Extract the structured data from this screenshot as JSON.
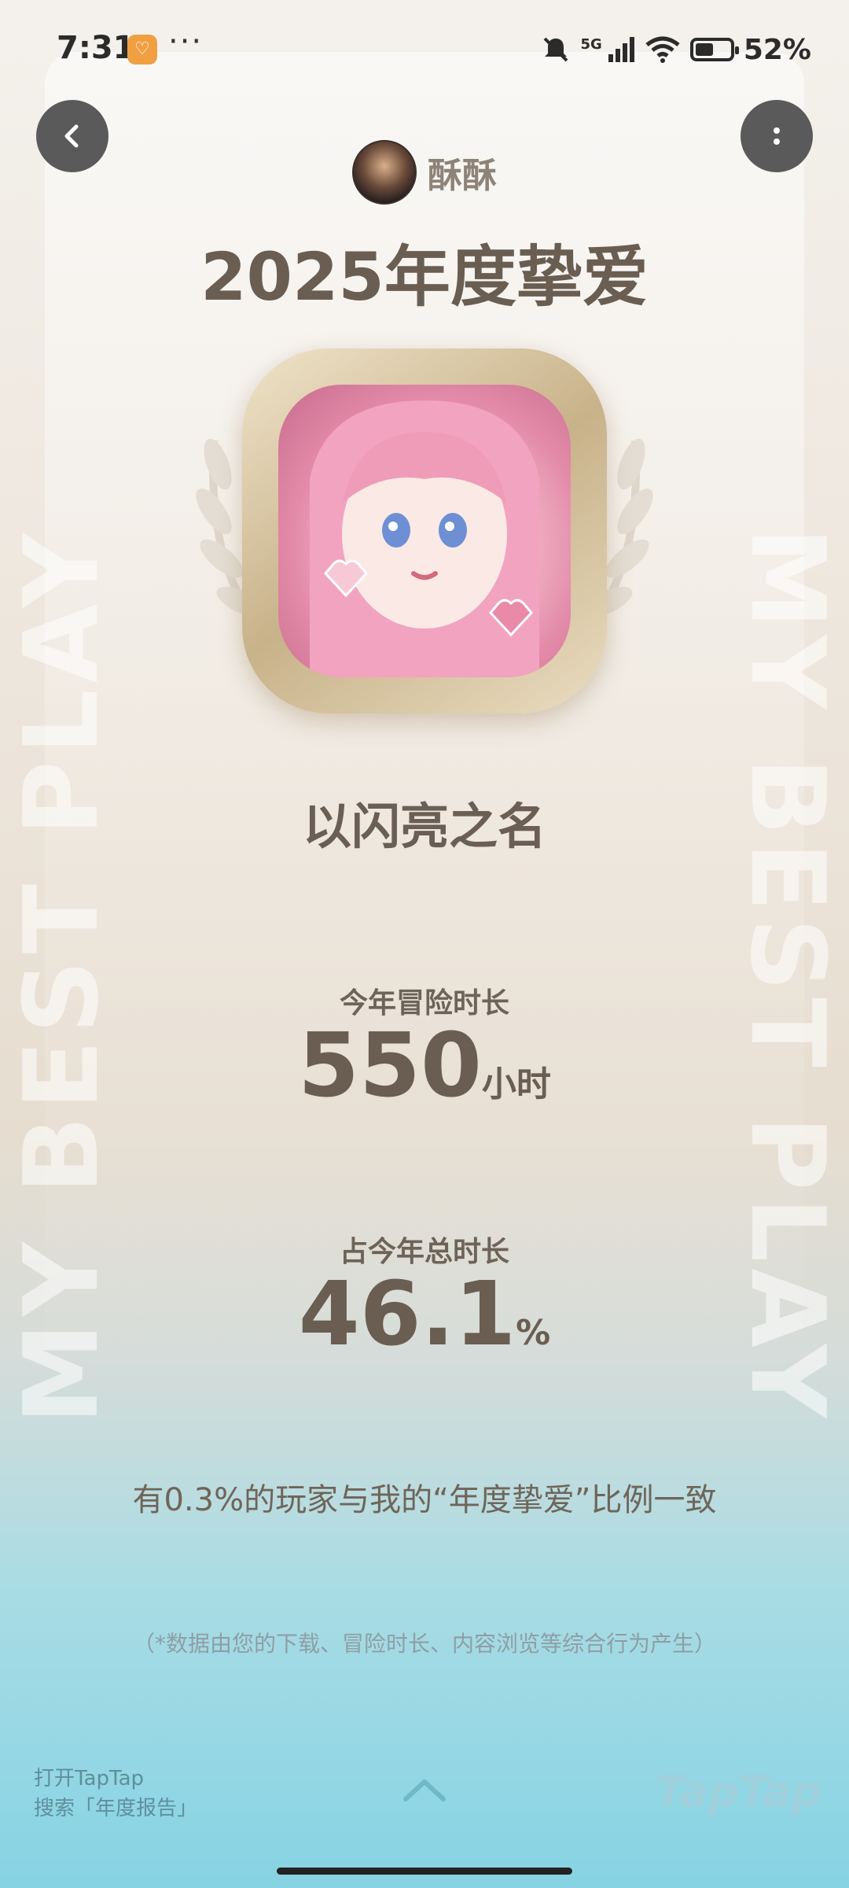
{
  "status_bar": {
    "time": "7:31",
    "more": "···",
    "network": "5G",
    "battery": "52%",
    "battery_level": 0.52,
    "icons": [
      "notification-app-icon",
      "mute-icon",
      "signal-icon",
      "wifi-icon",
      "battery-icon"
    ]
  },
  "header": {
    "back_icon": "chevron-left-icon",
    "menu_icon": "vertical-dots-icon",
    "username": "酥酥",
    "title": "2025年度挚爱"
  },
  "game": {
    "name": "以闪亮之名"
  },
  "background": {
    "watermark_left": "MY BEST PLAY",
    "watermark_right": "MY BEST PLAY"
  },
  "stats": {
    "playtime_label": "今年冒险时长",
    "playtime_value": "550",
    "playtime_unit": "小时",
    "share_label": "占今年总时长",
    "share_value": "46.1",
    "share_unit": "%"
  },
  "ratio_text": "有0.3%的玩家与我的“年度挚爱”比例一致",
  "footnote": "（*数据由您的下载、冒险时长、内容浏览等综合行为产生）",
  "footer": {
    "line1": "打开TapTap",
    "line2": "搜索「年度报告」",
    "brand": "TapTap"
  },
  "colors": {
    "title": "#6a5d52",
    "accent_teal": "#86d3e4",
    "button_bg": "#5a5a5a"
  }
}
